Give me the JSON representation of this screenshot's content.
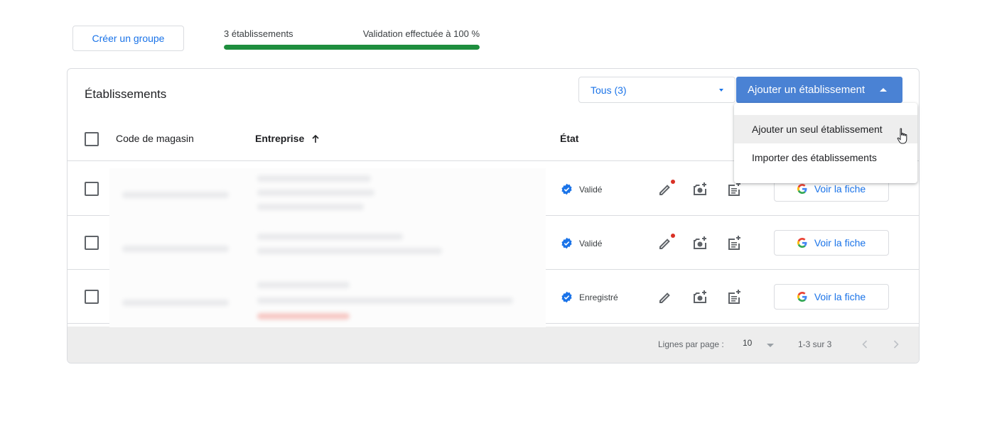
{
  "top": {
    "create_group_label": "Créer un groupe",
    "count_label": "3 établissements",
    "validation_label": "Validation effectuée à 100 %",
    "validation_progress_percent": 100
  },
  "card": {
    "title": "Établissements",
    "filter": {
      "selected": "Tous (3)"
    },
    "add_button_label": "Ajouter un établissement"
  },
  "table": {
    "columns": [
      "Code de magasin",
      "Entreprise",
      "État"
    ],
    "rows": [
      {
        "status": "Validé",
        "view_label": "Voir la fiche",
        "edit_notification": true
      },
      {
        "status": "Validé",
        "view_label": "Voir la fiche",
        "edit_notification": true
      },
      {
        "status": "Enregistré",
        "view_label": "Voir la fiche",
        "edit_notification": false
      }
    ],
    "icons": {
      "status": "verified-badge-icon",
      "edit": "pencil-icon",
      "photo": "add-photo-icon",
      "post": "add-post-icon",
      "view": "google-g-icon"
    }
  },
  "footer": {
    "rows_per_page_label": "Lignes par page :",
    "rows_per_page_value": "10",
    "range": "1-3 sur 3"
  },
  "menu": {
    "items": [
      "Ajouter un seul établissement",
      "Importer des établissements"
    ]
  },
  "colors": {
    "accent": "#1a73e8",
    "primary_button": "#4a82d4",
    "progress": "#1e8e3e",
    "notification_dot": "#d93025"
  }
}
